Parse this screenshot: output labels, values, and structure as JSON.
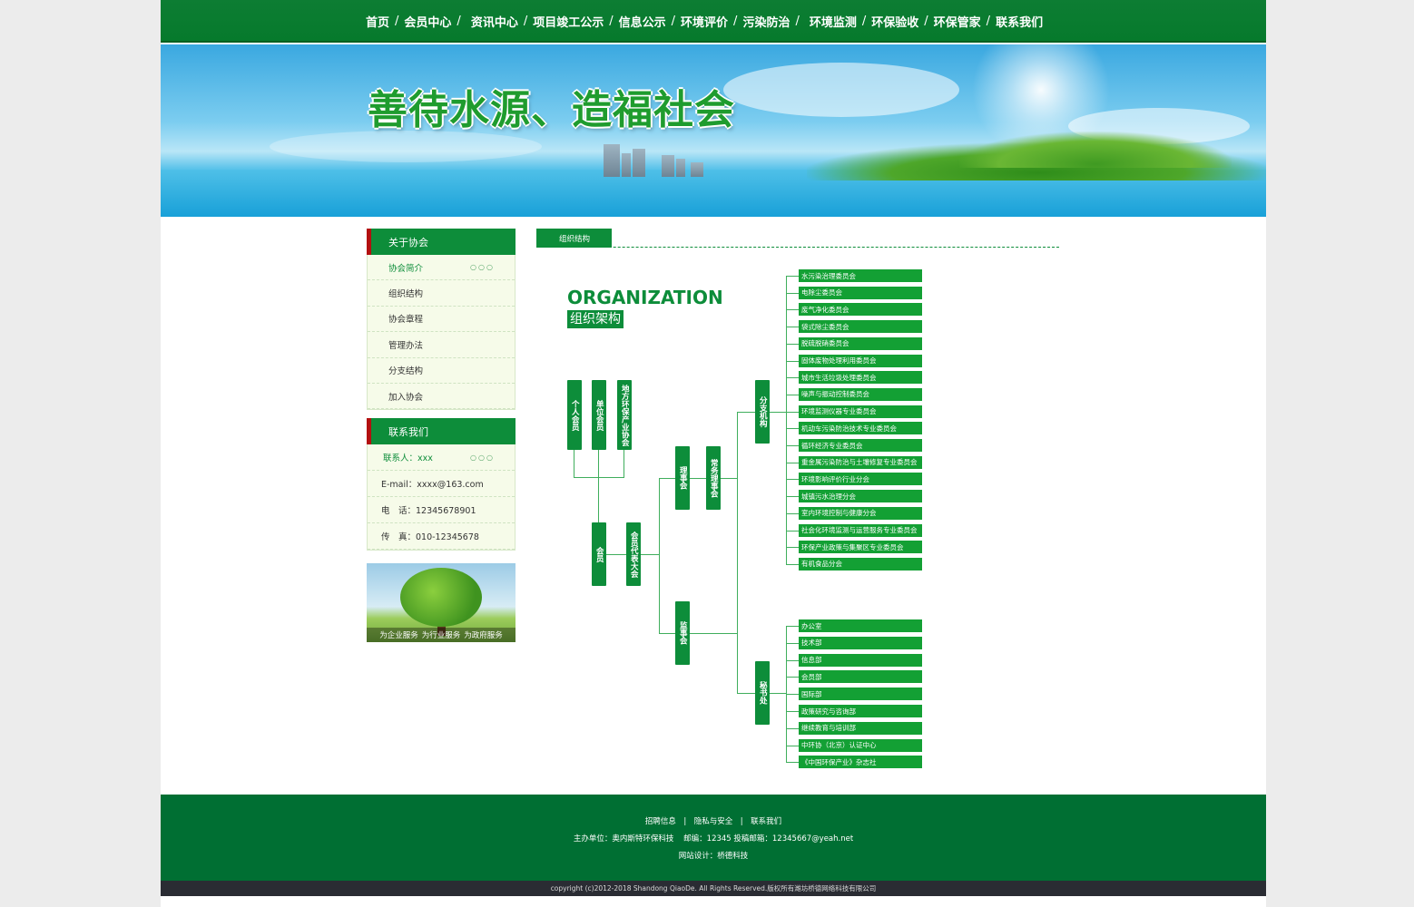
{
  "nav": {
    "items": [
      "首页",
      "会员中心",
      "资讯中心",
      "项目竣工公示",
      "信息公示",
      "环境评价",
      "污染防治",
      "环境监测",
      "环保验收",
      "环保管家",
      "联系我们"
    ]
  },
  "banner": {
    "slogan": "善待水源、造福社会"
  },
  "sidebar": {
    "about_title": "关于协会",
    "about_items": [
      "协会简介",
      "组织结构",
      "协会章程",
      "管理办法",
      "分支结构",
      "加入协会"
    ],
    "contact_title": "联系我们",
    "contact_items": [
      "联系人：xxx",
      "E-mail：xxxx@163.com",
      "电　话：12345678901",
      "传　真：010-12345678"
    ],
    "image_caption": [
      "为企业服务",
      "为行业服务",
      "为政府服务"
    ]
  },
  "main": {
    "tab": "组织结构",
    "org_title": "ORGANIZATION",
    "org_subtitle": "组织架构",
    "boxes": {
      "individual": "个人会员",
      "unit": "单位会员",
      "local": "地方环保产业协会",
      "member": "会员",
      "congress": "会员代表大会",
      "council": "理事会",
      "standing": "常务理事会",
      "supervisors": "监事会",
      "branch": "分支机构",
      "secretariat": "秘书处"
    },
    "branch_list": [
      "水污染治理委员会",
      "电除尘委员会",
      "废气净化委员会",
      "袋式除尘委员会",
      "脱硫脱硝委员会",
      "固体废物处理利用委员会",
      "城市生活垃圾处理委员会",
      "噪声与振动控制委员会",
      "环境监测仪器专业委员会",
      "机动车污染防治技术专业委员会",
      "循环经济专业委员会",
      "重金属污染防治与土壤修复专业委员会",
      "环境影响评价行业分会",
      "城镇污水治理分会",
      "室内环境控制与健康分会",
      "社会化环境监测与运营服务专业委员会",
      "环保产业政策与集聚区专业委员会",
      "有机食品分会"
    ],
    "secretariat_list": [
      "办公室",
      "技术部",
      "信息部",
      "会员部",
      "国际部",
      "政策研究与咨询部",
      "继续教育与培训部",
      "中环协（北京）认证中心",
      "《中国环保产业》杂志社"
    ]
  },
  "footer": {
    "links": [
      "招聘信息",
      "隐私与安全",
      "联系我们"
    ],
    "host": "主办单位：奥内斯特环保科技",
    "postal": "邮编：12345 投稿邮箱：12345667@yeah.net",
    "design": "网站设计：桥德科技",
    "copyright": "copyright (c)2012-2018 Shandong QiaoDe. All Rights Reserved.版权所有潍坊桥德网络科技有限公司"
  }
}
